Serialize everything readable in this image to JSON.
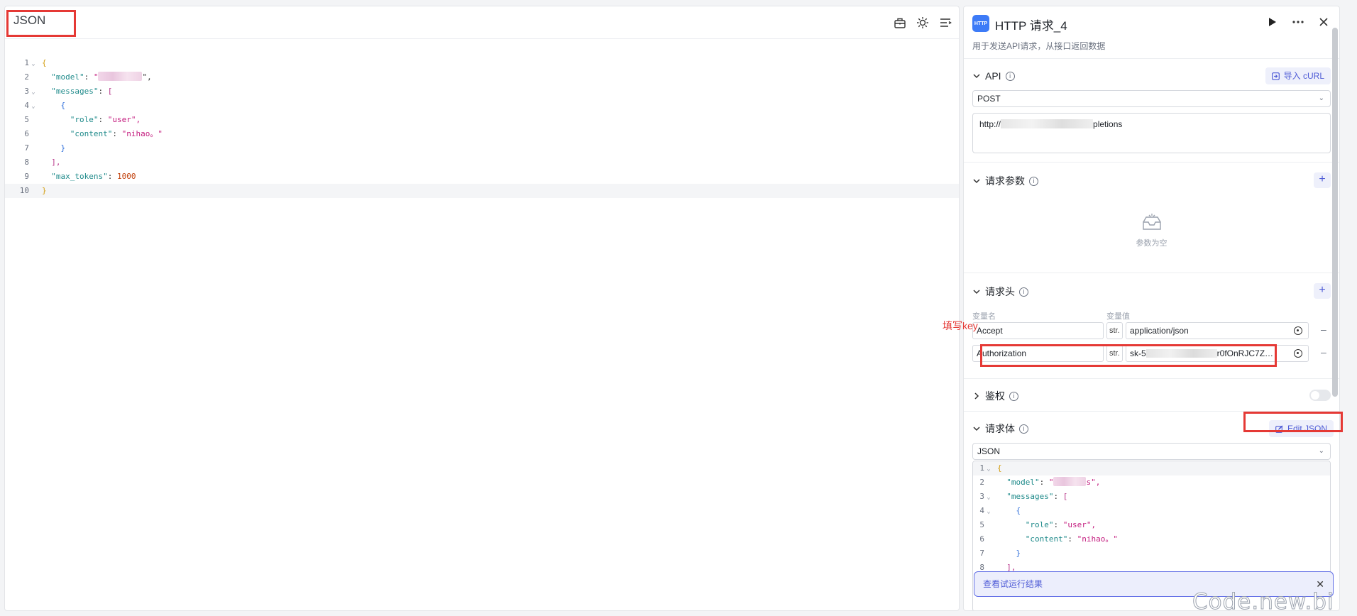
{
  "left": {
    "title": "JSON",
    "code": [
      {
        "n": "1",
        "fold": true
      },
      {
        "n": "2",
        "key": "\"model\"",
        "str_open": "\"",
        "str_close": "\","
      },
      {
        "n": "3",
        "fold": true,
        "key": "\"messages\"",
        "open": "["
      },
      {
        "n": "4",
        "fold": true,
        "open": "{"
      },
      {
        "n": "5",
        "key": "\"role\"",
        "val": "\"user\","
      },
      {
        "n": "6",
        "key": "\"content\"",
        "val": "\"nihao。\""
      },
      {
        "n": "7",
        "close": "}"
      },
      {
        "n": "8",
        "close": "],"
      },
      {
        "n": "9",
        "key": "\"max_tokens\"",
        "num": "1000"
      },
      {
        "n": "10",
        "close": "}"
      }
    ]
  },
  "node": {
    "icon_text": "HTTP",
    "title": "HTTP 请求_4",
    "description": "用于发送API请求，从接口返回数据"
  },
  "api": {
    "title": "API",
    "import_label": "导入 cURL",
    "method": "POST",
    "url_prefix": "http://",
    "url_suffix": "pletions"
  },
  "params": {
    "title": "请求参数",
    "empty": "参数为空"
  },
  "headers": {
    "title": "请求头",
    "col_name": "变量名",
    "col_value": "变量值",
    "rows": [
      {
        "name": "Accept",
        "type": "str.",
        "value": "application/json"
      },
      {
        "name": "Authorization",
        "type": "str.",
        "value_prefix": "sk-5",
        "value_suffix": "r0fOnRJC7Z…"
      }
    ]
  },
  "auth": {
    "title": "鉴权"
  },
  "body": {
    "title": "请求体",
    "edit_label": "Edit JSON",
    "format": "JSON",
    "code": [
      {
        "n": "1",
        "fold": true
      },
      {
        "n": "2",
        "key": "\"model\"",
        "str_open": "\"",
        "str_close": "s\","
      },
      {
        "n": "3",
        "fold": true,
        "key": "\"messages\"",
        "open": "["
      },
      {
        "n": "4",
        "fold": true,
        "open": "{"
      },
      {
        "n": "5",
        "key": "\"role\"",
        "val": "\"user\","
      },
      {
        "n": "6",
        "key": "\"content\"",
        "val": "\"nihao。\""
      },
      {
        "n": "7",
        "close": "}"
      },
      {
        "n": "8",
        "close": "],"
      }
    ]
  },
  "toast": {
    "text": "查看试运行结果"
  },
  "annotation": "填写key",
  "watermark": "Code.new.bi",
  "colors": {
    "accent": "#4e5bd6",
    "highlight_red": "#e53935",
    "json_key": "#1e8a8a",
    "json_string": "#c41d7f",
    "json_number": "#c2410c"
  }
}
